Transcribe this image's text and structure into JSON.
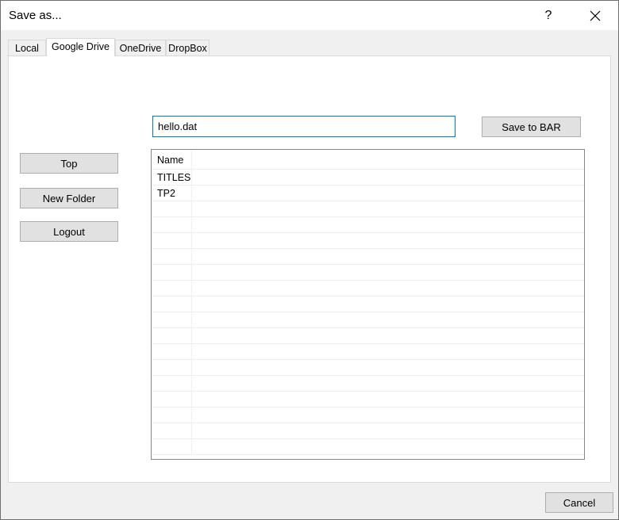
{
  "window": {
    "title": "Save as...",
    "help_label": "?"
  },
  "tabs": [
    {
      "label": "Local",
      "active": false
    },
    {
      "label": "Google Drive",
      "active": true
    },
    {
      "label": "OneDrive",
      "active": false
    },
    {
      "label": "DropBox",
      "active": false
    }
  ],
  "filename": {
    "value": "hello.dat"
  },
  "buttons": {
    "save": "Save to BAR",
    "top": "Top",
    "new_folder": "New Folder",
    "logout": "Logout",
    "cancel": "Cancel"
  },
  "file_list": {
    "header": "Name",
    "items": [
      "TITLES",
      "TP2"
    ],
    "empty_rows": 16
  },
  "colors": {
    "accent": "#0078d7",
    "button_bg": "#e1e1e1",
    "window_bg": "#f0f0f0"
  },
  "icons": {
    "close": "close-icon"
  }
}
